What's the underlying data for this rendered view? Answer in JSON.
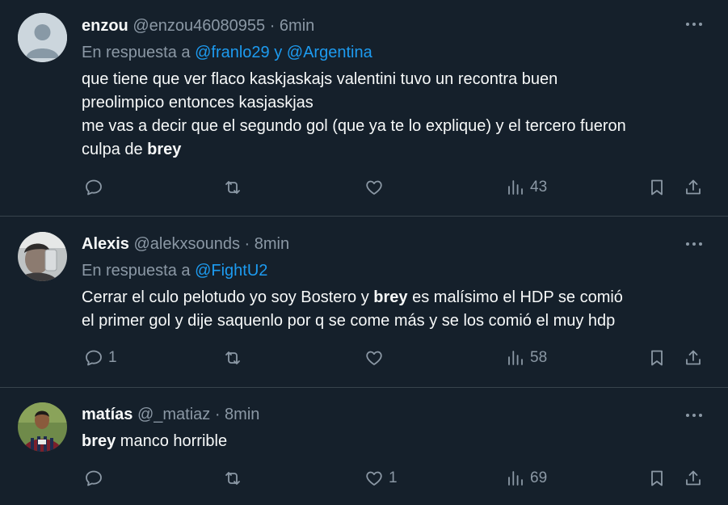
{
  "tweets": [
    {
      "name": "enzou",
      "handle": "@enzou46080955",
      "time": "· 6min",
      "reply_prefix": "En respuesta a",
      "reply_to": "@franlo29 y @Argentina",
      "lines": [
        "que tiene que ver flaco kaskjaskajs valentini tuvo un recontra buen",
        "preolimpico entonces kasjaskjas",
        "me vas a decir que el segundo gol (que ya te lo explique) y el tercero fueron",
        "culpa de "
      ],
      "bold_word": "brey",
      "replies": "",
      "likes": "",
      "views": "43"
    },
    {
      "name": "Alexis",
      "handle": "@alekxsounds",
      "time": "· 8min",
      "reply_prefix": "En respuesta a",
      "reply_to": "@FightU2",
      "line1_pre": "Cerrar el culo pelotudo yo soy Bostero y ",
      "bold_word": "brey",
      "line1_post": " es malísimo el HDP se comió",
      "line2": "el primer gol y dije saquenlo  por q se come más y se los comió el muy hdp",
      "replies": "1",
      "likes": "",
      "views": "58"
    },
    {
      "name": "matías",
      "handle": "@_matiaz",
      "time": "· 8min",
      "bold_word": "brey",
      "line1_post": " manco horrible",
      "replies": "",
      "likes": "1",
      "views": "69"
    }
  ],
  "icons": {
    "more": "more-horizontal-icon",
    "reply": "reply-icon",
    "retweet": "retweet-icon",
    "like": "like-icon",
    "views": "views-icon",
    "bookmark": "bookmark-icon",
    "share": "share-icon"
  },
  "colors": {
    "background": "#15202b",
    "accent": "#1d9bf0",
    "muted": "#8b98a5",
    "text": "#f7f9f9",
    "divider": "#38444d"
  }
}
